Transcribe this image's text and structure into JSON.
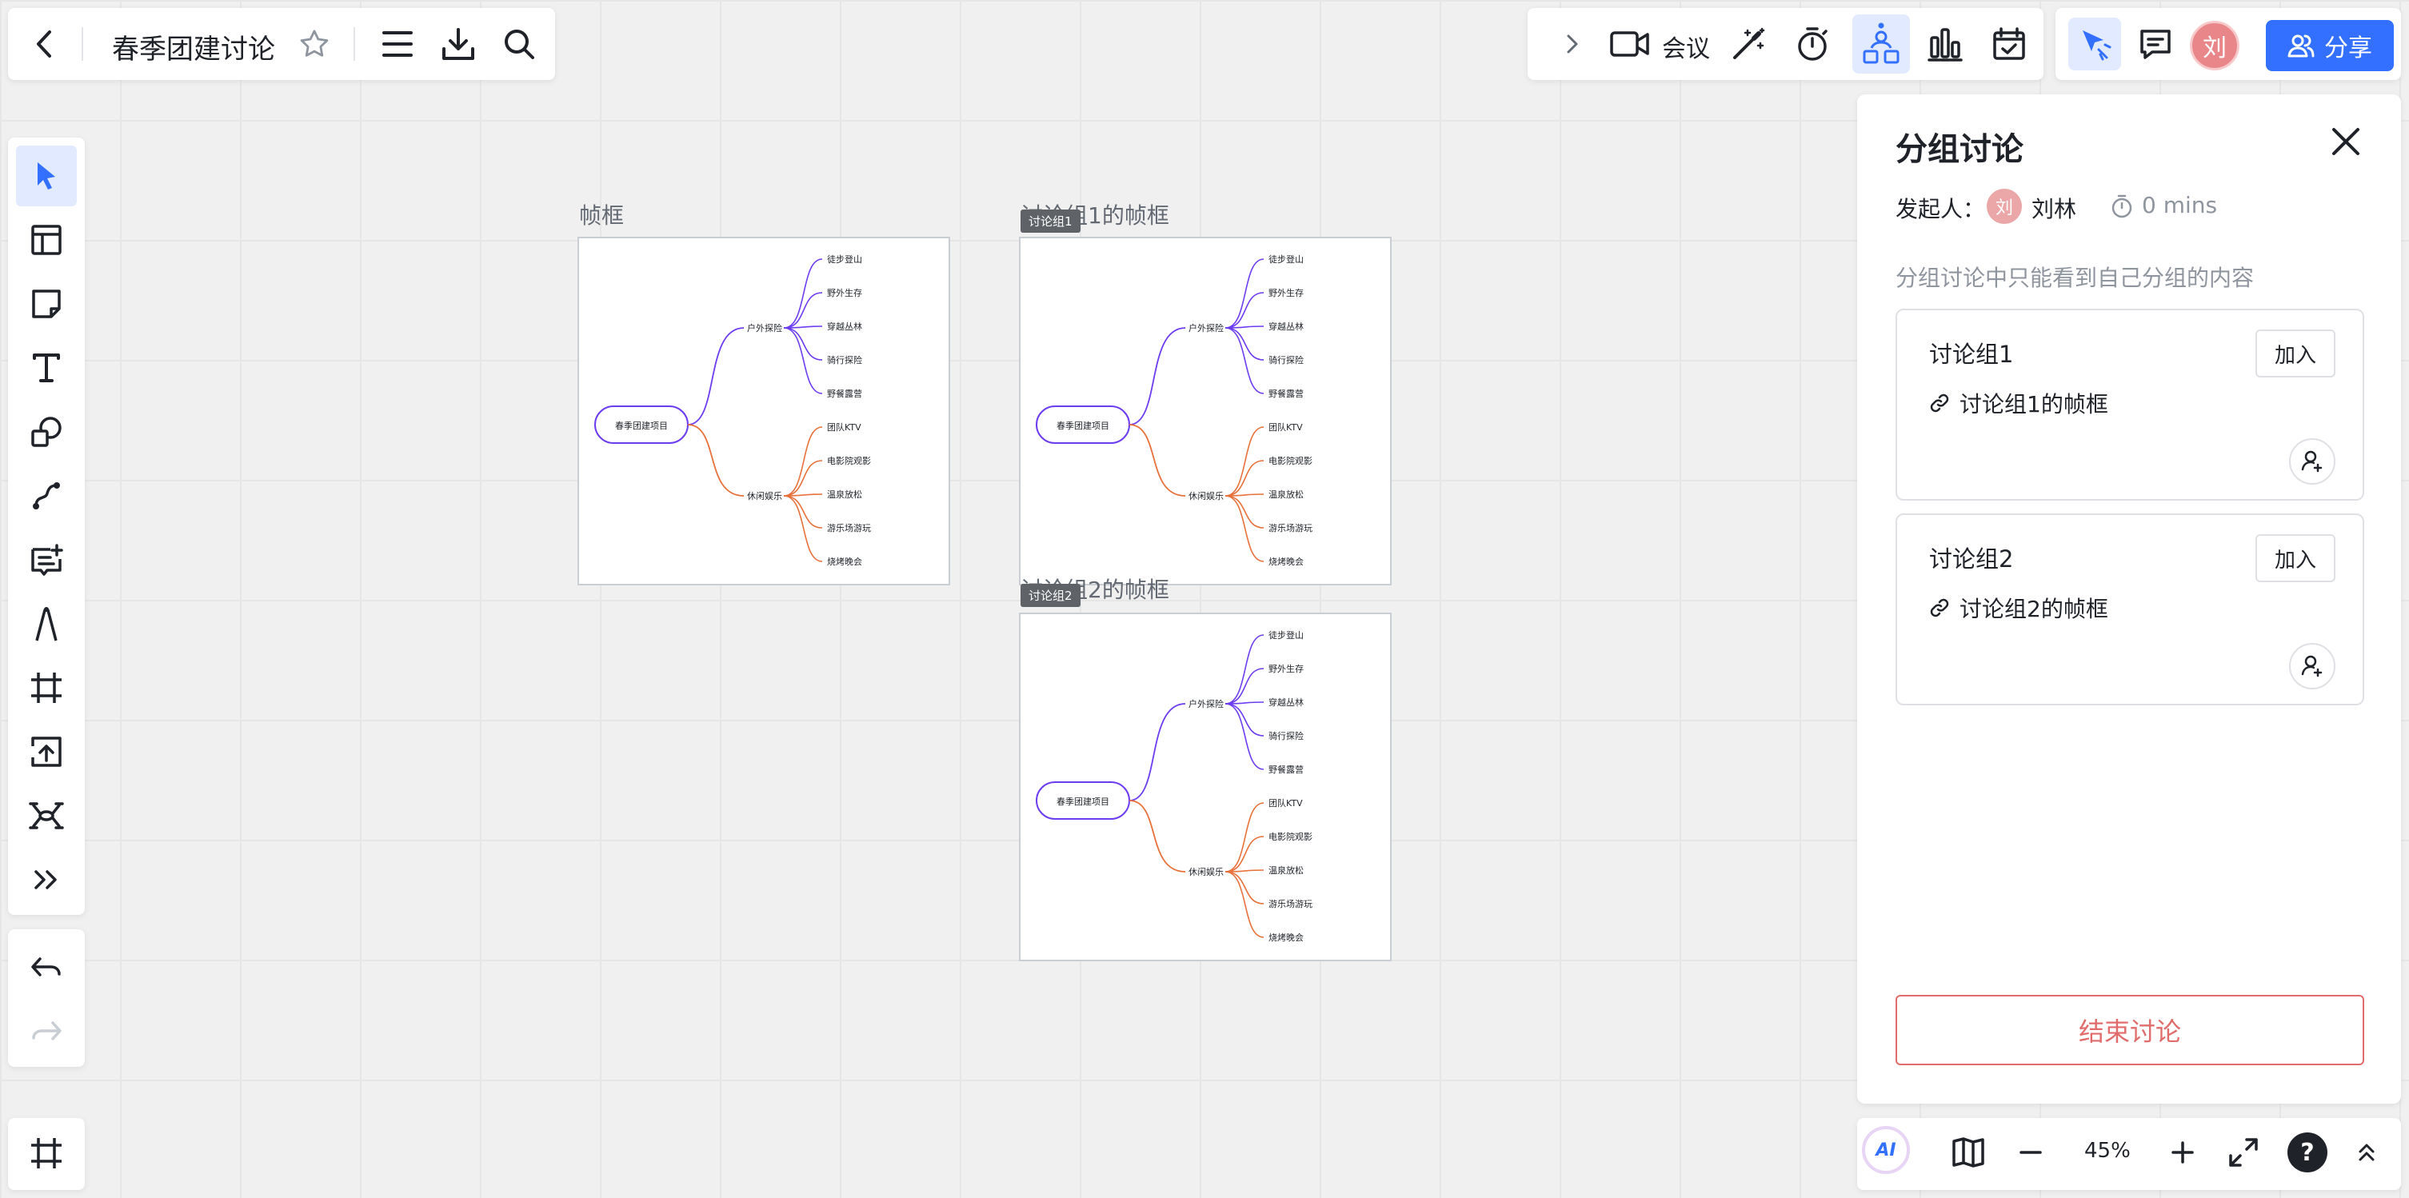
{
  "toolbar": {
    "back_icon": "chevron-left-icon",
    "title": "春季团建讨论",
    "favorite_icon": "star-icon",
    "menu_icon": "menu-icon",
    "download_icon": "download-icon",
    "search_icon": "search-icon"
  },
  "top_right": {
    "meeting_label": "会议",
    "share_label": "分享",
    "avatar_initial": "刘",
    "accent_color": "#3370ff"
  },
  "left_tools": [
    "select-tool",
    "template-tool",
    "sticky-note-tool",
    "text-tool",
    "shape-tool",
    "connector-tool",
    "comment-tool",
    "pen-tool",
    "frame-tool",
    "upload-tool",
    "mindmap-tool",
    "more-tools"
  ],
  "frames": [
    {
      "label": "帧框",
      "tag": ""
    },
    {
      "label": "讨论组1的帧框",
      "tag": "讨论组1"
    },
    {
      "label": "讨论组2的帧框",
      "tag": "讨论组2"
    }
  ],
  "mindmap": {
    "root": "春季团建项目",
    "branches": [
      {
        "label": "户外探险",
        "color": "#6c3cf0",
        "leaves": [
          "徒步登山",
          "野外生存",
          "穿越丛林",
          "骑行探险",
          "野餐露营"
        ]
      },
      {
        "label": "休闲娱乐",
        "color": "#e8703a",
        "leaves": [
          "团队KTV",
          "电影院观影",
          "温泉放松",
          "游乐场游玩",
          "烧烤晚会"
        ]
      }
    ]
  },
  "panel": {
    "title": "分组讨论",
    "initiator_label": "发起人：",
    "initiator_avatar": "刘",
    "initiator_name": "刘林",
    "timer": "0 mins",
    "hint": "分组讨论中只能看到自己分组的内容",
    "groups": [
      {
        "name": "讨论组1",
        "join": "加入",
        "frame": "讨论组1的帧框"
      },
      {
        "name": "讨论组2",
        "join": "加入",
        "frame": "讨论组2的帧框"
      }
    ],
    "end_button": "结束讨论"
  },
  "bottom": {
    "ai_label": "AI",
    "zoom": "45%",
    "help": "?"
  }
}
